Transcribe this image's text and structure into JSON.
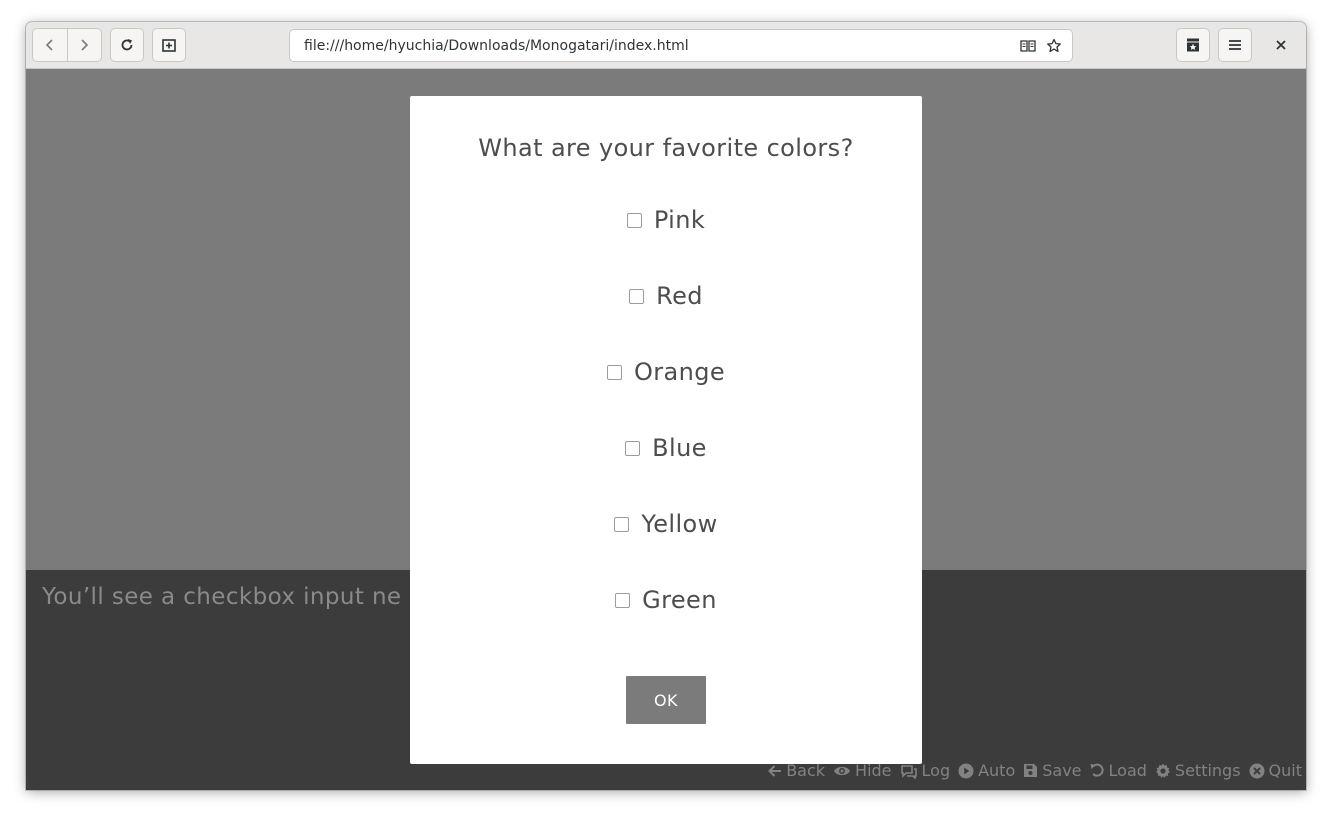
{
  "browser": {
    "url": "file:///home/hyuchia/Downloads/Monogatari/index.html"
  },
  "textbox": {
    "text": "You’ll see a checkbox input ne"
  },
  "dialog": {
    "title": "What are your favorite colors?",
    "options": [
      {
        "label": "Pink",
        "checked": false
      },
      {
        "label": "Red",
        "checked": false
      },
      {
        "label": "Orange",
        "checked": false
      },
      {
        "label": "Blue",
        "checked": false
      },
      {
        "label": "Yellow",
        "checked": false
      },
      {
        "label": "Green",
        "checked": false
      }
    ],
    "ok_label": "OK"
  },
  "quick_menu": [
    {
      "label": "Back",
      "icon": "arrow-left-icon"
    },
    {
      "label": "Hide",
      "icon": "eye-icon"
    },
    {
      "label": "Log",
      "icon": "comments-icon"
    },
    {
      "label": "Auto",
      "icon": "play-circle-icon"
    },
    {
      "label": "Save",
      "icon": "save-icon"
    },
    {
      "label": "Load",
      "icon": "undo-icon"
    },
    {
      "label": "Settings",
      "icon": "gear-icon"
    },
    {
      "label": "Quit",
      "icon": "times-circle-icon"
    }
  ],
  "colors": {
    "stage": "#7b7b7b",
    "textbox": "#3c3c3c",
    "dialog": "#ffffff",
    "button": "#7b7b7b"
  }
}
